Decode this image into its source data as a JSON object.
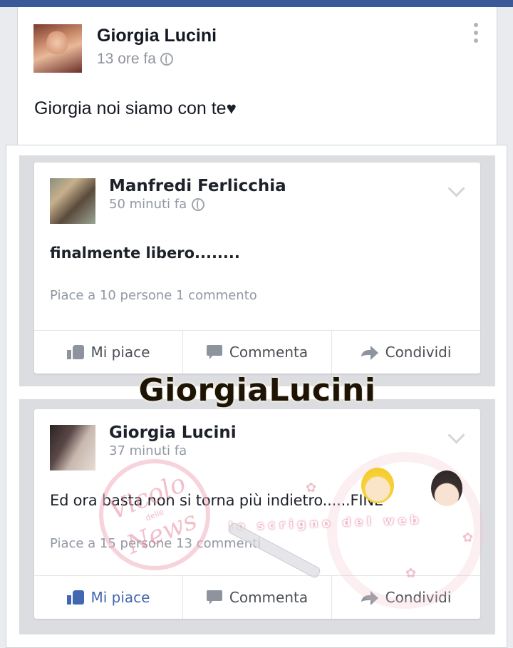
{
  "post": {
    "author": "Giorgia Lucini",
    "time": "13 ore fa",
    "text": "Giorgia noi siamo con te",
    "heart": "♥",
    "more_icon": "vertical-ellipsis-icon",
    "privacy_icon": "globe-icon"
  },
  "screenshot": {
    "overlay_title": "GiorgiaLucini",
    "posts": [
      {
        "author": "Manfredi Ferlicchia",
        "time": "50 minuti fa",
        "text": "finalmente libero........",
        "stats": "Piace a 10 persone   1 commento",
        "actions": [
          "Mi piace",
          "Commenta",
          "Condividi"
        ],
        "liked": false
      },
      {
        "author": "Giorgia Lucini",
        "time": "37 minuti fa",
        "text": "Ed ora basta non si torna più indietro......FINE",
        "stats": "Piace a 15 persone   13 commenti",
        "actions": [
          "Mi piace",
          "Commenta",
          "Condividi"
        ],
        "liked": true
      }
    ],
    "watermark": {
      "line1": "Vicolo",
      "line2": "delle",
      "line3": "News",
      "brand": "lo scrigno del web"
    }
  },
  "colors": {
    "facebook_blue": "#3b5998",
    "like_blue": "#4267b2",
    "text_dark": "#141823",
    "meta_gray": "#90949c"
  }
}
